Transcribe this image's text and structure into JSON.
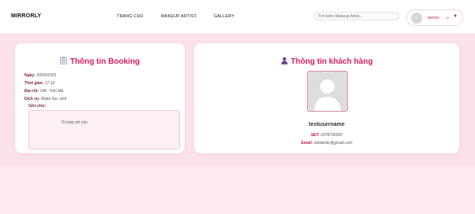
{
  "header": {
    "logo": "MIRRORLY",
    "nav": [
      {
        "label": "TRANG CHỦ"
      },
      {
        "label": "MAKEUP ARTIST"
      },
      {
        "label": "GALLERY"
      }
    ],
    "search_placeholder": "Tìm kiếm Makeup Artist...",
    "user": {
      "avatar_initial": "L",
      "name": "lamnv",
      "badge": "IS",
      "caret": "▼"
    }
  },
  "booking": {
    "title": "Thông tin Booking",
    "fields": [
      {
        "label": "Ngày:",
        "value": "30/09/2025"
      },
      {
        "label": "Thời gian:",
        "value": "17:12"
      },
      {
        "label": "Địa chỉ:",
        "value": "148 - Kim Mã"
      },
      {
        "label": "Dịch vụ:",
        "value": "Make học sinh"
      }
    ],
    "notes_label": "Ghi chú:",
    "notes_text": "Dị ứng với cồn"
  },
  "customer": {
    "title": "Thông tin khách hàng",
    "username": "testusername",
    "phone_label": "SĐT:",
    "phone": "0378790992",
    "email_label": "Email:",
    "email": "vietlamkc@gmail.com"
  },
  "colors": {
    "accent": "#d81b60",
    "background": "#fde9ee",
    "band": "#fbe1e8"
  },
  "icons": {
    "booking_title": "notepad-icon",
    "customer_title": "person-icon",
    "user_menu": "caret-down-icon"
  }
}
